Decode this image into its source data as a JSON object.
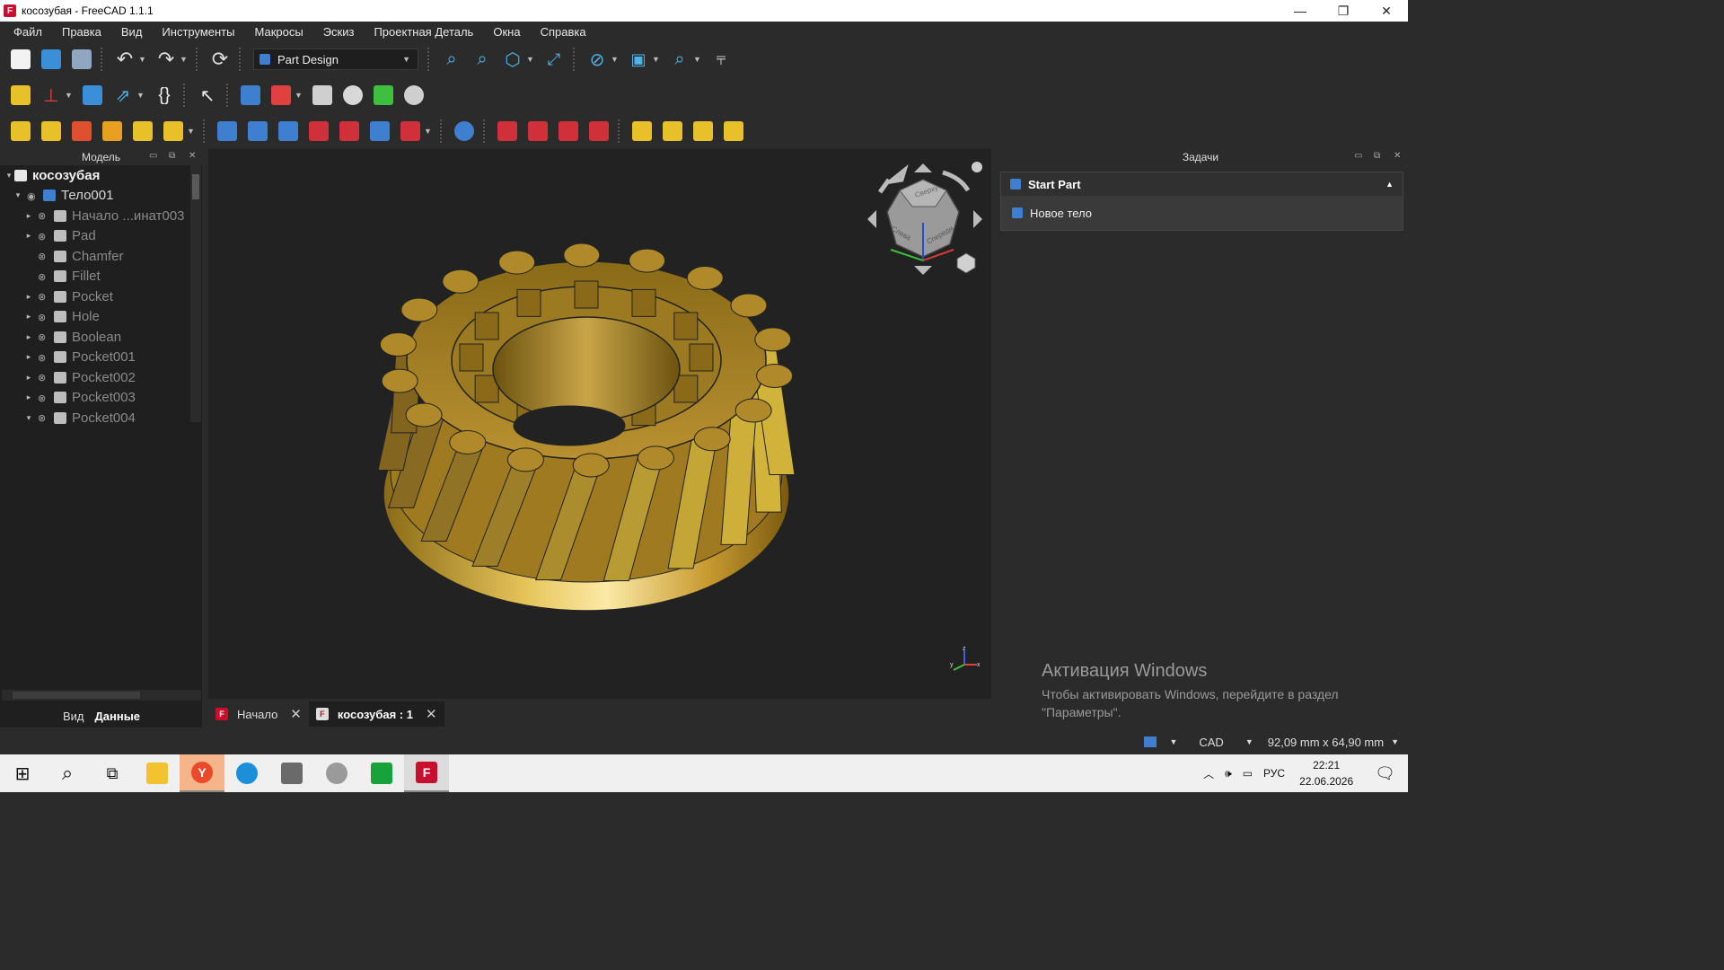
{
  "window": {
    "title": "косозубая - FreeCAD 1.1.1",
    "app_icon": "F",
    "controls": {
      "minimize": "—",
      "restore": "❐",
      "close": "✕"
    }
  },
  "menu": [
    "Файл",
    "Правка",
    "Вид",
    "Инструменты",
    "Макросы",
    "Эскиз",
    "Проектная Деталь",
    "Окна",
    "Справка"
  ],
  "workbench": {
    "selected": "Part Design"
  },
  "model_panel": {
    "title": "Модель",
    "tree": [
      {
        "label": "косозубая",
        "level": 0,
        "expander": "▾",
        "bold": true,
        "icon": "document-icon"
      },
      {
        "label": "Тело001",
        "level": 1,
        "expander": "▾",
        "bold": false,
        "icon": "body-icon"
      },
      {
        "label": "Начало ...инат003",
        "level": 2,
        "expander": "▸",
        "dim": true,
        "icon": "origin-icon"
      },
      {
        "label": "Pad",
        "level": 2,
        "expander": "▸",
        "dim": true,
        "icon": "pad-icon"
      },
      {
        "label": "Chamfer",
        "level": 2,
        "expander": "",
        "dim": true,
        "icon": "chamfer-icon"
      },
      {
        "label": "Fillet",
        "level": 2,
        "expander": "",
        "dim": true,
        "icon": "fillet-icon"
      },
      {
        "label": "Pocket",
        "level": 2,
        "expander": "▸",
        "dim": true,
        "icon": "pocket-icon"
      },
      {
        "label": "Hole",
        "level": 2,
        "expander": "▸",
        "dim": true,
        "icon": "hole-icon"
      },
      {
        "label": "Boolean",
        "level": 2,
        "expander": "▸",
        "dim": true,
        "icon": "boolean-icon"
      },
      {
        "label": "Pocket001",
        "level": 2,
        "expander": "▸",
        "dim": true,
        "icon": "pocket-icon"
      },
      {
        "label": "Pocket002",
        "level": 2,
        "expander": "▸",
        "dim": true,
        "icon": "pocket-icon"
      },
      {
        "label": "Pocket003",
        "level": 2,
        "expander": "▸",
        "dim": true,
        "icon": "pocket-icon"
      },
      {
        "label": "Pocket004",
        "level": 2,
        "expander": "▾",
        "dim": true,
        "icon": "pocket-icon"
      }
    ],
    "tabs": {
      "view": "Вид",
      "data": "Данные"
    }
  },
  "tasks_panel": {
    "title": "Задачи",
    "task_box_title": "Start Part",
    "task_item": "Новое тело"
  },
  "navcube": {
    "top": "Сверху",
    "left": "Слева",
    "front": "Спереди"
  },
  "doc_tabs": [
    {
      "label": "Начало",
      "active": false
    },
    {
      "label": "косозубая : 1",
      "active": true
    }
  ],
  "activation": {
    "title": "Активация Windows",
    "text": "Чтобы активировать Windows, перейдите в раздел \"Параметры\"."
  },
  "statusbar": {
    "nav_style": "CAD",
    "dimensions": "92,09 mm x 64,90 mm"
  },
  "taskbar": {
    "lang": "РУС",
    "time": "22:21",
    "date": "22.06.2026"
  },
  "colors": {
    "gear": "#b8902a",
    "viewport": "#222222",
    "accent": "#3f7fd0"
  }
}
